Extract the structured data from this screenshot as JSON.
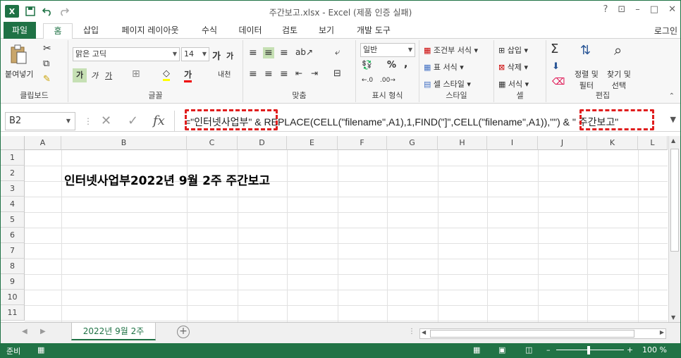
{
  "title": "주간보고.xlsx - Excel (제품 인증 실패)",
  "window_controls": [
    "?",
    "⊡",
    "–",
    "□",
    "✕"
  ],
  "quick_access": {
    "app_icon": "X",
    "save_icon": "save-icon",
    "undo_icon": "undo-icon",
    "redo_icon": "redo-icon"
  },
  "tabs": [
    "파일",
    "홈",
    "삽입",
    "페이지 레이아웃",
    "수식",
    "데이터",
    "검토",
    "보기",
    "개발 도구"
  ],
  "login": "로그인",
  "ribbon": {
    "clipboard": {
      "label": "클립보드",
      "paste": "붙여넣기"
    },
    "font": {
      "label": "글꼴",
      "name": "맑은 고딕",
      "size": "14",
      "bold": "가",
      "italic": "가",
      "underline": "가",
      "grow": "가",
      "shrink": "가",
      "phonetic": "내천"
    },
    "align": {
      "label": "맞춤"
    },
    "number": {
      "label": "표시 형식",
      "format": "일반",
      "percent": "%",
      "comma": ","
    },
    "styles": {
      "label": "스타일",
      "cond": "조건부 서식",
      "table": "표 서식",
      "cell": "셀 스타일"
    },
    "cells": {
      "label": "셀",
      "insert": "삽입",
      "delete": "삭제",
      "format": "서식"
    },
    "edit": {
      "label": "편집",
      "sort": "정렬 및",
      "sort2": "필터",
      "find": "찾기 및",
      "find2": "선택"
    }
  },
  "namebox": "B2",
  "formula": {
    "part1": "=\"인터넷사업부\" ",
    "part2": "& REPLACE(CELL(\"filename\",A1),1,FIND(\"]\",CELL(\"filename\",A1)),\"\") ",
    "part3": "& \" 주간보고\""
  },
  "columns": [
    "A",
    "B",
    "C",
    "D",
    "E",
    "F",
    "G",
    "H",
    "I",
    "J",
    "K",
    "L"
  ],
  "rows": [
    "1",
    "2",
    "3",
    "4",
    "5",
    "6",
    "7",
    "8",
    "9",
    "10",
    "11"
  ],
  "cell_B2": "인터넷사업부2022년 9월 2주 주간보고",
  "sheet_tab": "2022년 9월 2주",
  "status": {
    "ready": "준비",
    "zoom": "100 %"
  }
}
